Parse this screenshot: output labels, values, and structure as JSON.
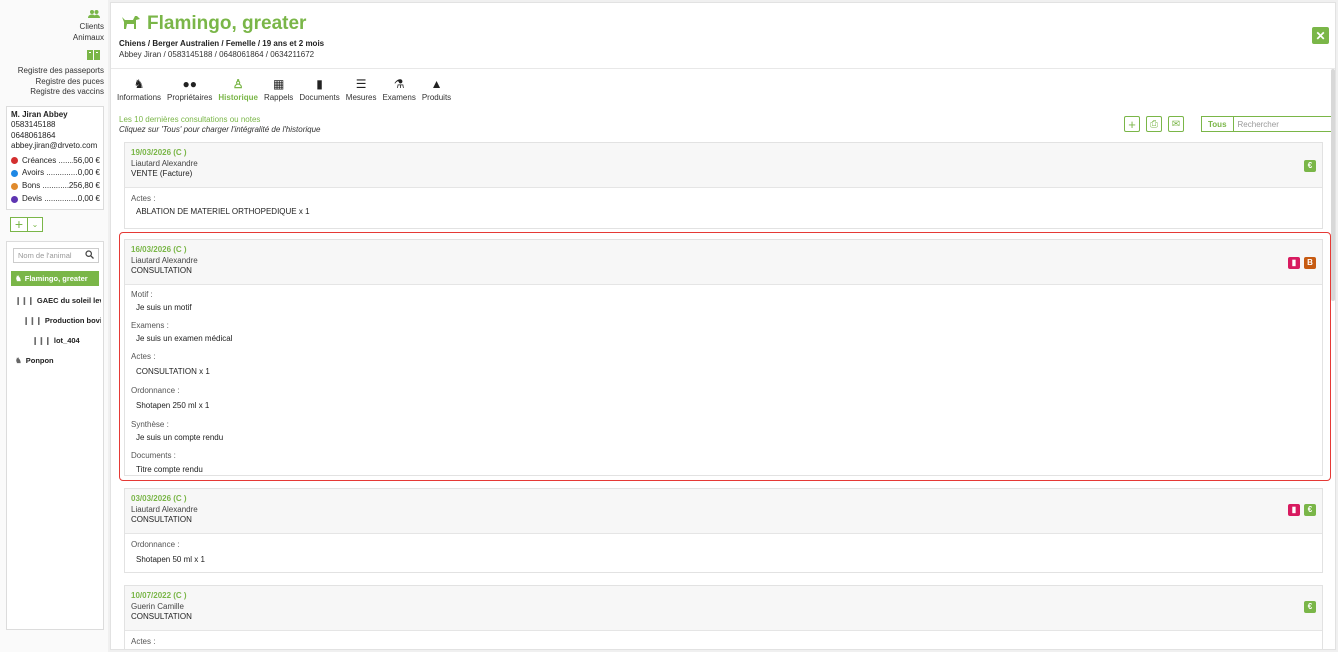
{
  "nav": {
    "clients": "Clients",
    "animaux": "Animaux",
    "registres": [
      "Registre des passeports",
      "Registre des puces",
      "Registre des vaccins"
    ]
  },
  "client": {
    "name": "M. Jiran Abbey",
    "phones": [
      "0583145188",
      "0648061864"
    ],
    "email": "abbey.jiran@drveto.com",
    "balances": [
      {
        "label": "Créances ........",
        "value": "56,00 €",
        "color": "#d32f2f"
      },
      {
        "label": "Avoirs ...............",
        "value": "0,00 €",
        "color": "#1e88e5"
      },
      {
        "label": "Bons ............",
        "value": "256,80 €",
        "color": "#e08a2c"
      },
      {
        "label": "Devis .................",
        "value": "0,00 €",
        "color": "#5e35b1"
      }
    ]
  },
  "animal_search": {
    "placeholder": "Nom de l'animal"
  },
  "tree": [
    {
      "label": "Flamingo, greater",
      "icon": "dog-icon"
    },
    {
      "label": "GAEC du soleil leva...",
      "icon": "herd-icon"
    },
    {
      "label": "Production bovi...",
      "icon": "herd-icon"
    },
    {
      "label": "lot_404",
      "icon": "herd-icon"
    },
    {
      "label": "Ponpon",
      "icon": "horse-icon"
    }
  ],
  "header": {
    "title": "Flamingo, greater",
    "subtitle": "Chiens / Berger Australien / Femelle / 19 ans et 2 mois",
    "contact": "Abbey Jiran / 0583145188 / 0648061864 / 0634211672"
  },
  "tabs": [
    "Informations",
    "Propriétaires",
    "Historique",
    "Rappels",
    "Documents",
    "Mesures",
    "Examens",
    "Produits"
  ],
  "history": {
    "info": "Les 10 dernières consultations ou notes",
    "hint": "Cliquez sur 'Tous' pour charger l'intégralité de l'historique",
    "tous": "Tous",
    "search_placeholder": "Rechercher"
  },
  "consultations": [
    {
      "date": "19/03/2026 (C )",
      "vet": "Liautard Alexandre",
      "type": "VENTE (Facture)",
      "sections": [
        {
          "label": "Actes :",
          "value": "ABLATION DE MATERIEL ORTHOPEDIQUE  x 1"
        }
      ]
    },
    {
      "date": "16/03/2026 (C )",
      "vet": "Liautard Alexandre",
      "type": "CONSULTATION",
      "sections": [
        {
          "label": "Motif :",
          "value": "Je suis un motif"
        },
        {
          "label": "Examens :",
          "value": "Je suis un examen médical"
        },
        {
          "label": "Actes :",
          "value": "CONSULTATION  x 1"
        },
        {
          "label": "Ordonnance :",
          "value": "Shotapen 250 ml  x 1"
        },
        {
          "label": "Synthèse :",
          "value": "Je suis un compte rendu"
        },
        {
          "label": "Documents :",
          "value": "Titre compte rendu"
        }
      ],
      "badge_b": "B"
    },
    {
      "date": "03/03/2026 (C )",
      "vet": "Liautard Alexandre",
      "type": "CONSULTATION",
      "sections": [
        {
          "label": "Ordonnance :",
          "value": "Shotapen 50 ml  x 1"
        }
      ]
    },
    {
      "date": "10/07/2022 (C )",
      "vet": "Guerin Camille",
      "type": "CONSULTATION",
      "sections": [
        {
          "label": "Actes :",
          "value": ""
        }
      ]
    }
  ]
}
